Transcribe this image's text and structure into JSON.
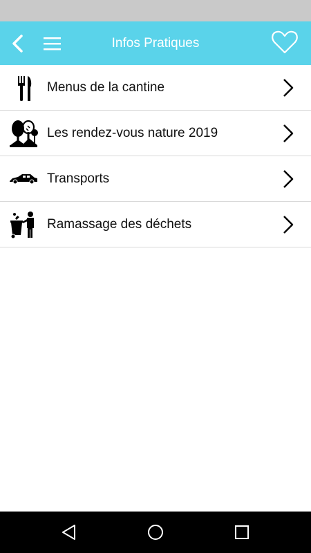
{
  "app_bar": {
    "title": "Infos Pratiques",
    "back_icon": "chevron-left-icon",
    "menu_icon": "hamburger-menu-icon",
    "favorite_icon": "heart-outline-icon",
    "background_color": "#5ad3ea"
  },
  "items": [
    {
      "label": "Menus de la cantine",
      "icon": "fork-knife-icon"
    },
    {
      "label": "Les rendez-vous nature 2019",
      "icon": "trees-icon"
    },
    {
      "label": "Transports",
      "icon": "car-icon"
    },
    {
      "label": "Ramassage des déchets",
      "icon": "trash-disposal-icon"
    }
  ],
  "nav_bar": {
    "back_icon": "triangle-back-icon",
    "home_icon": "circle-home-icon",
    "recents_icon": "square-recents-icon"
  }
}
